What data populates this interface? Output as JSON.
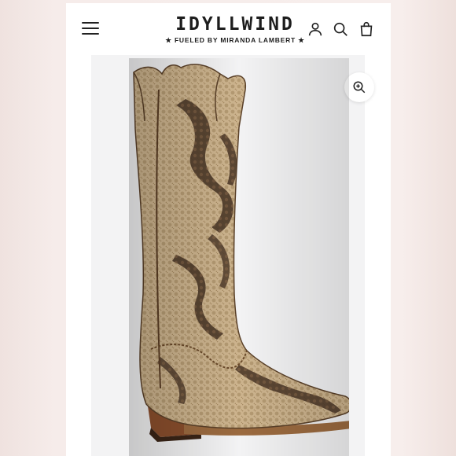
{
  "header": {
    "brand_name": "IDYLLWIND",
    "brand_tagline": "★ FUELED BY MIRANDA LAMBERT ★",
    "icons": [
      "menu-icon",
      "account-icon",
      "search-icon",
      "cart-icon"
    ]
  },
  "gallery": {
    "zoom_icon": "zoom-in-icon",
    "product_image": "snakeskin-cowboy-boot"
  },
  "colors": {
    "background": "#f1e4e1",
    "header_bg": "#ffffff",
    "text": "#1d1d1d",
    "gallery_bg": "#f3f3f4"
  }
}
